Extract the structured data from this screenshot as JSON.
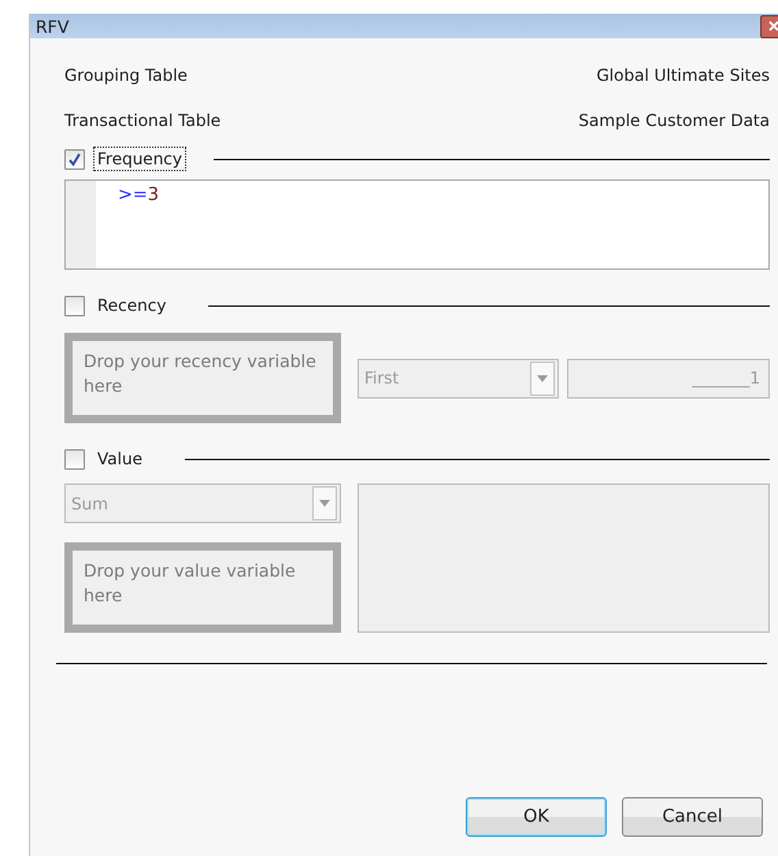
{
  "window": {
    "title": "RFV"
  },
  "info": [
    {
      "label": "Grouping Table",
      "value": "Global Ultimate Sites"
    },
    {
      "label": "Transactional Table",
      "value": "Sample Customer Data"
    }
  ],
  "frequency": {
    "label": "Frequency",
    "checked": true,
    "focused": true,
    "expression": [
      {
        "text": ">=",
        "kind": "operator"
      },
      {
        "text": "3",
        "kind": "number"
      }
    ]
  },
  "recency": {
    "label": "Recency",
    "checked": false,
    "disabled": true,
    "drop_hint": "Drop your recency variable here",
    "mode": "First",
    "amount": "_______1"
  },
  "value": {
    "label": "Value",
    "checked": false,
    "disabled": true,
    "aggregate": "Sum",
    "drop_hint": "Drop your value variable here"
  },
  "buttons": [
    {
      "label": "OK",
      "default": true
    },
    {
      "label": "Cancel",
      "default": false
    }
  ]
}
